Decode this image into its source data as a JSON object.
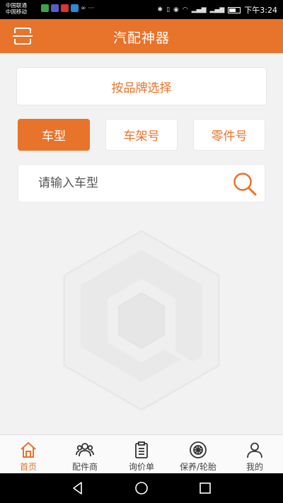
{
  "status_bar": {
    "carrier_1": "中国联通",
    "carrier_2": "中国移动",
    "time": "下午3:24",
    "more": "···"
  },
  "app_bar": {
    "title": "汽配神器",
    "scan_icon": "scan-icon"
  },
  "brand_select": {
    "label": "按品牌选择"
  },
  "search_tabs": [
    {
      "label": "车型",
      "active": true
    },
    {
      "label": "车架号",
      "active": false
    },
    {
      "label": "零件号",
      "active": false
    }
  ],
  "search": {
    "placeholder": "请输入车型",
    "icon": "search-icon"
  },
  "bottom_tabs": [
    {
      "label": "首页",
      "icon": "home-icon",
      "active": true
    },
    {
      "label": "配件商",
      "icon": "users-icon",
      "active": false
    },
    {
      "label": "询价单",
      "icon": "clipboard-icon",
      "active": false
    },
    {
      "label": "保养/轮胎",
      "icon": "tire-icon",
      "active": false
    },
    {
      "label": "我的",
      "icon": "person-icon",
      "active": false
    }
  ],
  "colors": {
    "accent": "#e8732a",
    "background": "#f2f2f2"
  }
}
